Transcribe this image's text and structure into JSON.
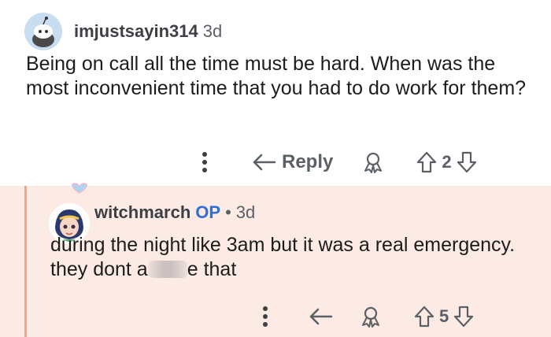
{
  "comment": {
    "username": "imjustsayin314",
    "age": "3d",
    "text": "Being on call all the time must be hard. When was the most inconvenient time that you had to do work for them?",
    "reply_label": "Reply",
    "score": "2"
  },
  "reply": {
    "username": "witchmarch",
    "op_badge": "OP",
    "separator": "•",
    "age": "3d",
    "text_before": "during the night like 3am but it was a real emergency. they dont a",
    "text_after": "e that",
    "score": "5"
  },
  "colors": {
    "op_accent": "#2e6fd6",
    "reply_background": "#fcebe5",
    "thread_line": "#f0a58c",
    "icon_gray": "#5b5f66"
  }
}
